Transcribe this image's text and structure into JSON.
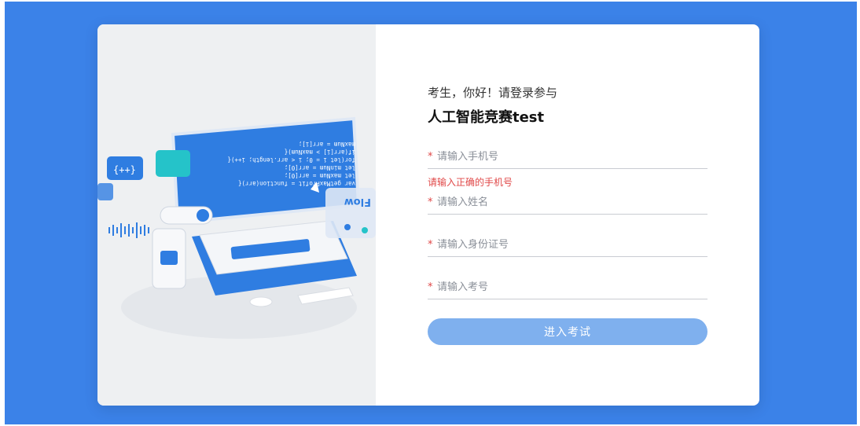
{
  "login": {
    "greeting": "考生，你好！请登录参与",
    "title": "人工智能竞赛test",
    "phone": {
      "placeholder": "请输入手机号",
      "value": "",
      "error": "请输入正确的手机号"
    },
    "name": {
      "placeholder": "请输入姓名",
      "value": ""
    },
    "id_card": {
      "placeholder": "请输入身份证号",
      "value": ""
    },
    "exam_no": {
      "placeholder": "请输入考号",
      "value": ""
    },
    "required_mark": "*",
    "submit_label": "进入考试"
  },
  "illustration": {
    "code_lines": [
      "var getMaxProfit = function(arr){",
      "let maxNum = arr[0];",
      "let minNum = arr[0];",
      "for(let i = 0; i < arr.length; i++){",
      "if(arr[i] > maxNum){",
      "maxNum = arr[i];"
    ],
    "badge_text": "{++}",
    "flow_text": "Flow"
  },
  "colors": {
    "background": "#3b82e8",
    "accent": "#2f7de1",
    "error": "#e04848",
    "button": "#7fb0ee"
  }
}
